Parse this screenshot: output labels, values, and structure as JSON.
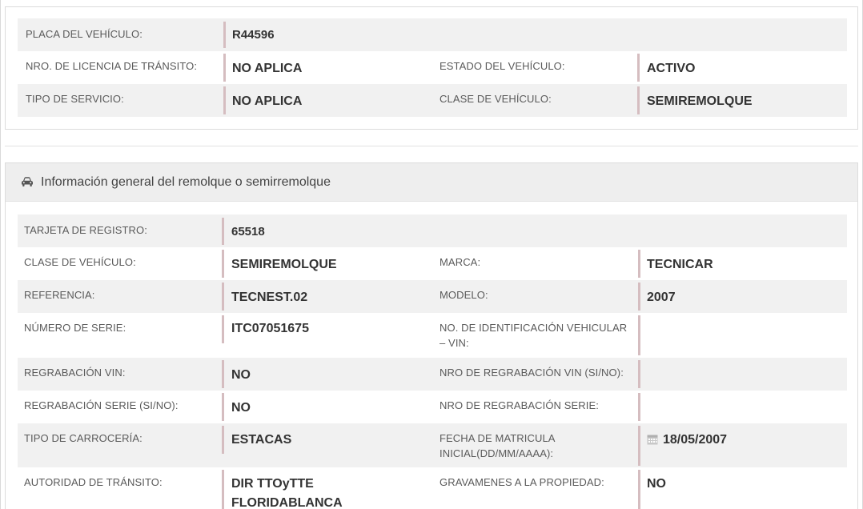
{
  "top_section": {
    "rows": [
      {
        "label1": "PLACA DEL VEHÍCULO:",
        "value1": "R44596"
      },
      {
        "label1": "NRO. DE LICENCIA DE TRÁNSITO:",
        "value1": "NO APLICA",
        "label2": "ESTADO DEL VEHÍCULO:",
        "value2": "ACTIVO"
      },
      {
        "label1": "TIPO DE SERVICIO:",
        "value1": "NO APLICA",
        "label2": "CLASE DE VEHÍCULO:",
        "value2": "SEMIREMOLQUE"
      }
    ]
  },
  "trailer_section": {
    "heading": "Información general del remolque o semirremolque",
    "icon": "car-icon",
    "rows": [
      {
        "label1": "TARJETA DE REGISTRO:",
        "value1": "65518"
      },
      {
        "label1": "CLASE DE VEHÍCULO:",
        "value1": "SEMIREMOLQUE",
        "label2": "MARCA:",
        "value2": "TECNICAR"
      },
      {
        "label1": "REFERENCIA:",
        "value1": "TECNEST.02",
        "label2": "MODELO:",
        "value2": "2007"
      },
      {
        "label1": "NÚMERO DE SERIE:",
        "value1": "ITC07051675",
        "label2a": "NO. DE IDENTIFICACIÓN VEHICULAR",
        "label2b": "– VIN:",
        "value2": ""
      },
      {
        "label1": "REGRABACIÓN VIN:",
        "value1": "NO",
        "label2": "NRO DE REGRABACIÓN VIN (SI/NO):",
        "value2": ""
      },
      {
        "label1": "REGRABACIÓN SERIE (SI/NO):",
        "value1": "NO",
        "label2": "NRO DE REGRABACIÓN SERIE:",
        "value2": ""
      },
      {
        "label1": "TIPO DE CARROCERÍA:",
        "value1": "ESTACAS",
        "label2a": "FECHA DE MATRICULA",
        "label2b": "INICIAL(DD/MM/AAAA):",
        "value2": "18/05/2007",
        "value2_icon": "calendar-icon"
      },
      {
        "label1": "AUTORIDAD DE TRÁNSITO:",
        "value1a": "DIR TTOyTTE",
        "value1b": "FLORIDABLANCA",
        "label2": "GRAVAMENES A LA PROPIEDAD:",
        "value2": "NO"
      }
    ]
  }
}
